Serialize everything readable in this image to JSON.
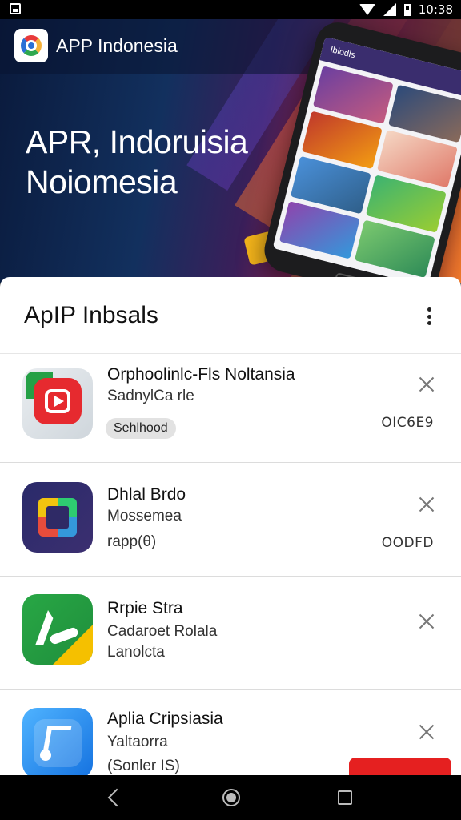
{
  "status_bar": {
    "time": "10:38"
  },
  "header": {
    "app_name": "APP Indonesia",
    "hero_title_line1": "APR, Indoruisia",
    "hero_title_line2": "Noiomesia"
  },
  "phone_mockup": {
    "header_text": "Iblodls"
  },
  "sheet": {
    "title": "ApIP Inbsals"
  },
  "apps": [
    {
      "title": "Orphoolinlc-Fls Noltansia",
      "subtitle": "SadnylCa rle",
      "chip": "Sehlhood",
      "right_value": "OIC6E9"
    },
    {
      "title": "Dhlal Brdo",
      "subtitle": "Mossemea",
      "meta": "rapp(θ)",
      "right_value": "OODFD"
    },
    {
      "title": "Rrpie Stra",
      "subtitle": "Cadaroet Rolala",
      "meta": "Lanolcta"
    },
    {
      "title": "Aplia Cripsiasia",
      "subtitle": "Yaltaorra",
      "meta": "(Sonler IS)"
    }
  ],
  "colors": {
    "accent_red": "#e52020",
    "hero_dark": "#0a1a3c",
    "hero_orange": "#f07a2a"
  }
}
